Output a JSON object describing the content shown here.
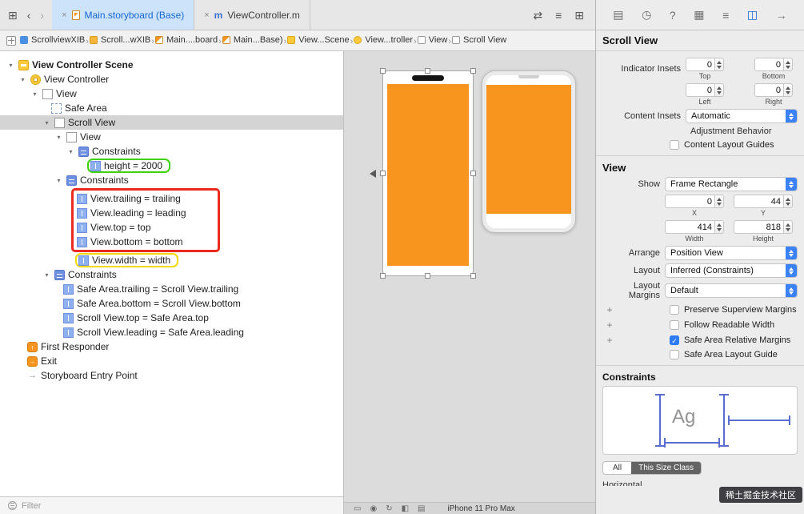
{
  "colors": {
    "accent_blue": "#1767d2",
    "tab_highlight": "#cce3f9",
    "orange_view": "#f7951e",
    "selection_gray": "#d4d4d4",
    "highlight_green": "#3ed10c",
    "highlight_red": "#ea2a1f",
    "highlight_yellow": "#f2d900",
    "panel_bg": "#ececec",
    "canvas_bg": "#dcdcdc"
  },
  "tab_bar": {
    "left_icons": [
      "tab-overview",
      "back",
      "forward"
    ],
    "tabs": [
      {
        "title": "Main.storyboard (Base)",
        "icon": "storyboard-file",
        "active": true
      },
      {
        "title": "ViewController.m",
        "icon": "objc-file",
        "active": false
      }
    ],
    "right_icons": [
      "swap-editors",
      "editor-options",
      "add-editor"
    ]
  },
  "jump_bar": {
    "items": [
      {
        "icon": "project",
        "label": "ScrollviewXIB"
      },
      {
        "icon": "folder",
        "label": "Scroll...wXIB"
      },
      {
        "icon": "storyboard",
        "label": "Main....board"
      },
      {
        "icon": "storyboard",
        "label": "Main...Base)"
      },
      {
        "icon": "scene",
        "label": "View...Scene"
      },
      {
        "icon": "view-controller",
        "label": "View...troller"
      },
      {
        "icon": "view",
        "label": "View"
      },
      {
        "icon": "scroll-view",
        "label": "Scroll View"
      }
    ]
  },
  "outline": {
    "rows": [
      {
        "level": 0,
        "icon": "scene-folder",
        "label": "View Controller Scene",
        "bold": true,
        "disclosure": true
      },
      {
        "level": 1,
        "icon": "view-controller",
        "label": "View Controller",
        "disclosure": true
      },
      {
        "level": 2,
        "icon": "view",
        "label": "View",
        "disclosure": true
      },
      {
        "level": 3,
        "icon": "safe-area",
        "label": "Safe Area"
      },
      {
        "level": 3,
        "icon": "scroll-view",
        "label": "Scroll View",
        "disclosure": true,
        "selected": true
      },
      {
        "level": 4,
        "icon": "view",
        "label": "View",
        "disclosure": true
      },
      {
        "level": 5,
        "icon": "constraints",
        "label": "Constraints",
        "disclosure": true
      },
      {
        "level": 6,
        "icon": "constraint",
        "label": "height = 2000",
        "box": "green"
      },
      {
        "level": 4,
        "icon": "constraints",
        "label": "Constraints",
        "disclosure": true
      },
      {
        "level": 5,
        "icon": "constraint",
        "label": "View.trailing = trailing",
        "group": "red"
      },
      {
        "level": 5,
        "icon": "constraint",
        "label": "View.leading = leading",
        "group": "red"
      },
      {
        "level": 5,
        "icon": "constraint",
        "label": "View.top = top",
        "group": "red"
      },
      {
        "level": 5,
        "icon": "constraint",
        "label": "View.bottom = bottom",
        "group": "red"
      },
      {
        "level": 5,
        "icon": "constraint",
        "label": "View.width = width",
        "box": "yellow"
      },
      {
        "level": 3,
        "icon": "constraints",
        "label": "Constraints",
        "disclosure": true
      },
      {
        "level": 4,
        "icon": "constraint",
        "label": "Safe Area.trailing = Scroll View.trailing"
      },
      {
        "level": 4,
        "icon": "constraint",
        "label": "Safe Area.bottom = Scroll View.bottom"
      },
      {
        "level": 4,
        "icon": "constraint",
        "label": "Scroll View.top = Safe Area.top"
      },
      {
        "level": 4,
        "icon": "constraint",
        "label": "Scroll View.leading = Safe Area.leading"
      },
      {
        "level": 1,
        "icon": "first-responder",
        "label": "First Responder"
      },
      {
        "level": 1,
        "icon": "exit",
        "label": "Exit"
      },
      {
        "level": 1,
        "icon": "entry-point",
        "label": "Storyboard Entry Point"
      }
    ]
  },
  "filter_bar": {
    "placeholder": "Filter"
  },
  "canvas": {
    "device_label": "iPhone 11 Pro Max",
    "bar_icons": [
      "device",
      "pin",
      "rotate",
      "split",
      "grid"
    ]
  },
  "inspector": {
    "selector_icons": [
      "file",
      "history",
      "quick-help",
      "identity",
      "attributes",
      "size",
      "connections"
    ],
    "selected_icon": "size",
    "scroll_view": {
      "title": "Scroll View",
      "indicator_insets_label": "Indicator Insets",
      "insets": [
        {
          "value": "0",
          "label": "Top"
        },
        {
          "value": "0",
          "label": "Bottom"
        },
        {
          "value": "0",
          "label": "Left"
        },
        {
          "value": "0",
          "label": "Right"
        }
      ],
      "content_insets_label": "Content Insets",
      "content_insets_value": "Automatic",
      "adjustment_behavior_label": "Adjustment Behavior",
      "content_layout_guides": {
        "label": "Content Layout Guides",
        "checked": false
      }
    },
    "view": {
      "title": "View",
      "show_label": "Show",
      "show_value": "Frame Rectangle",
      "frame": [
        {
          "value": "0",
          "label": "X"
        },
        {
          "value": "44",
          "label": "Y"
        },
        {
          "value": "414",
          "label": "Width"
        },
        {
          "value": "818",
          "label": "Height"
        }
      ],
      "arrange_label": "Arrange",
      "arrange_value": "Position View",
      "layout_label": "Layout",
      "layout_value": "Inferred (Constraints)",
      "layout_margins_label": "Layout Margins",
      "layout_margins_value": "Default",
      "checkboxes": [
        {
          "label": "Preserve Superview Margins",
          "checked": false,
          "plus": true
        },
        {
          "label": "Follow Readable Width",
          "checked": false,
          "plus": true
        },
        {
          "label": "Safe Area Relative Margins",
          "checked": true,
          "plus": true
        },
        {
          "label": "Safe Area Layout Guide",
          "checked": false,
          "plus": false
        }
      ]
    },
    "constraints": {
      "title": "Constraints",
      "preview_text": "Ag",
      "filter_all": "All",
      "filter_size_class": "This Size Class",
      "bottom_label": "Horizontal"
    }
  },
  "watermark": "稀土掘金技术社区"
}
